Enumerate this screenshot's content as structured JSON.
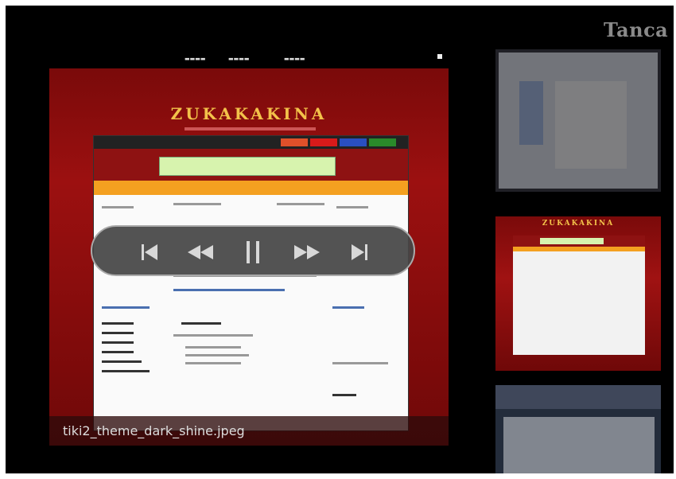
{
  "viewer": {
    "close_label": "Tanca",
    "caption": "tiki2_theme_dark_shine.jpeg"
  },
  "slide": {
    "brand_text": "ZUKAKAKINA"
  },
  "thumbnail_2": {
    "brand_text": "ZUKAKAKINA"
  },
  "controls": [
    {
      "name": "previous-icon"
    },
    {
      "name": "rewind-icon"
    },
    {
      "name": "pause-icon"
    },
    {
      "name": "fast-forward-icon"
    },
    {
      "name": "next-icon"
    }
  ],
  "colors": {
    "background": "#000000",
    "slide_red": "#9c1010",
    "brand_gold": "#f3c24a",
    "control_bar": "#464646",
    "close_label": "#8a8a8a"
  }
}
